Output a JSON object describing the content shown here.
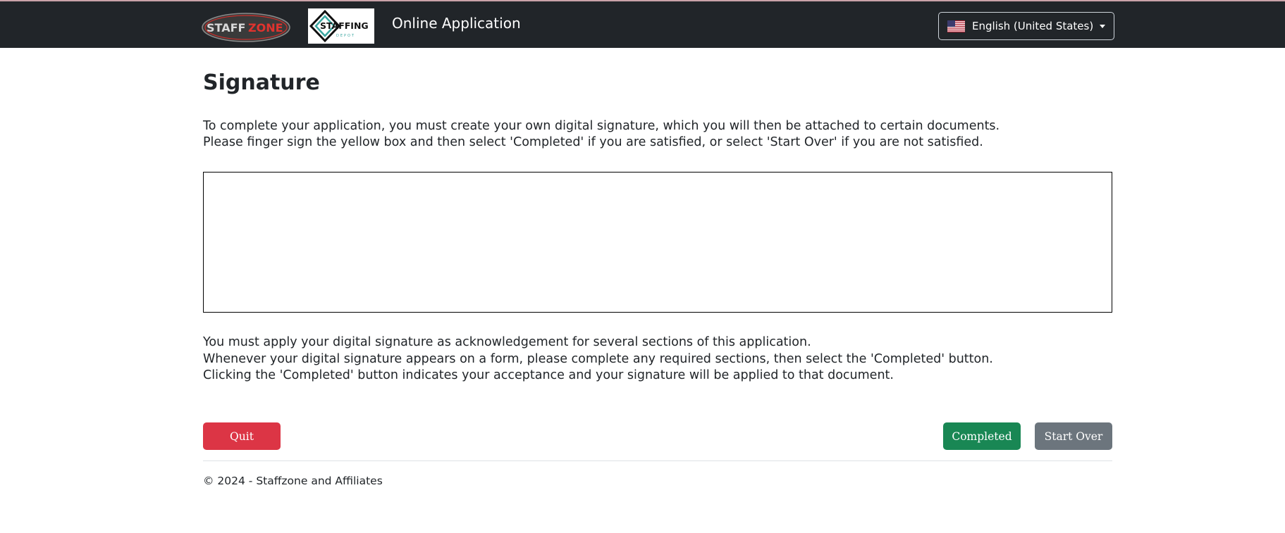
{
  "header": {
    "logo_text_1": "STAFF",
    "logo_text_2": "ZONE",
    "logo2_text_main": "STAFFING",
    "logo2_text_sub": "DEPOT",
    "app_title": "Online Application",
    "language": "English (United States)"
  },
  "main": {
    "heading": "Signature",
    "intro_lines": [
      "To complete your application, you must create your own digital signature, which you will then be attached to certain documents.",
      "Please finger sign the yellow box and then select 'Completed' if you are satisfied, or select 'Start Over' if you are not satisfied."
    ],
    "notes_lines": [
      "You must apply your digital signature as acknowledgement for several sections of this application.",
      "Whenever your digital signature appears on a form, please complete any required sections, then select the 'Completed' button.",
      "Clicking the 'Completed' button indicates your acceptance and your signature will be applied to that document."
    ]
  },
  "buttons": {
    "quit": "Quit",
    "completed": "Completed",
    "start_over": "Start Over"
  },
  "footer": {
    "copyright": "© 2024 - Staffzone and Affiliates"
  },
  "colors": {
    "topbar": "#212529",
    "quit": "#dc3545",
    "completed": "#198754",
    "start_over": "#6c757d"
  }
}
